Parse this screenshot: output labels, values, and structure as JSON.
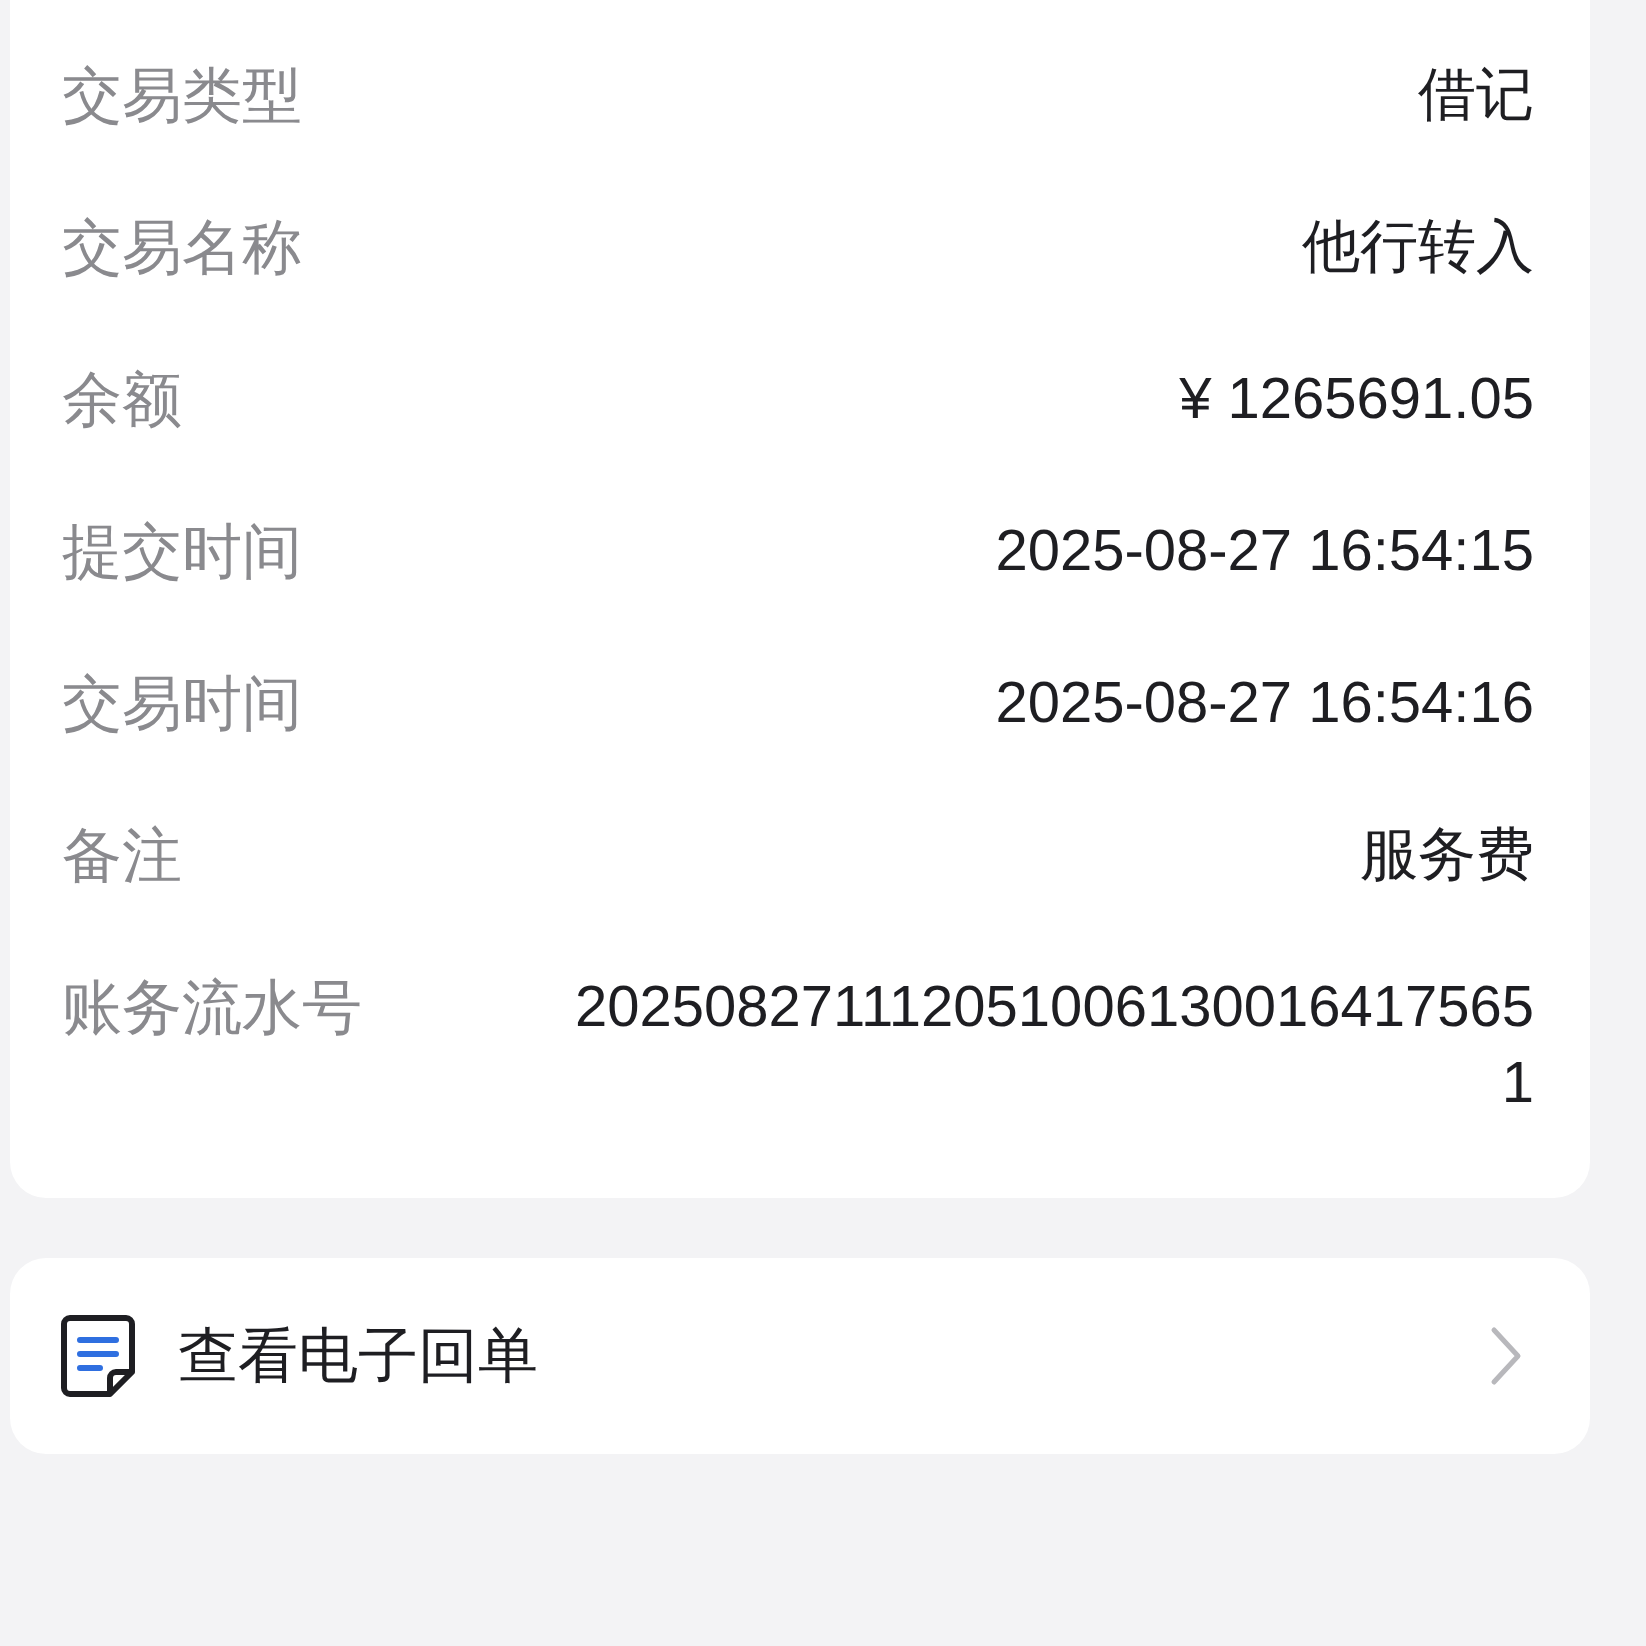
{
  "details": [
    {
      "label": "交易类型",
      "value": "借记"
    },
    {
      "label": "交易名称",
      "value": "他行转入"
    },
    {
      "label": "余额",
      "value": "¥ 1265691.05"
    },
    {
      "label": "提交时间",
      "value": "2025-08-27 16:54:15"
    },
    {
      "label": "交易时间",
      "value": "2025-08-27 16:54:16"
    },
    {
      "label": "备注",
      "value": "服务费"
    },
    {
      "label": "账务流水号",
      "value": "2025082711120510061300164175651"
    }
  ],
  "receipt_link": {
    "label": "查看电子回单"
  }
}
